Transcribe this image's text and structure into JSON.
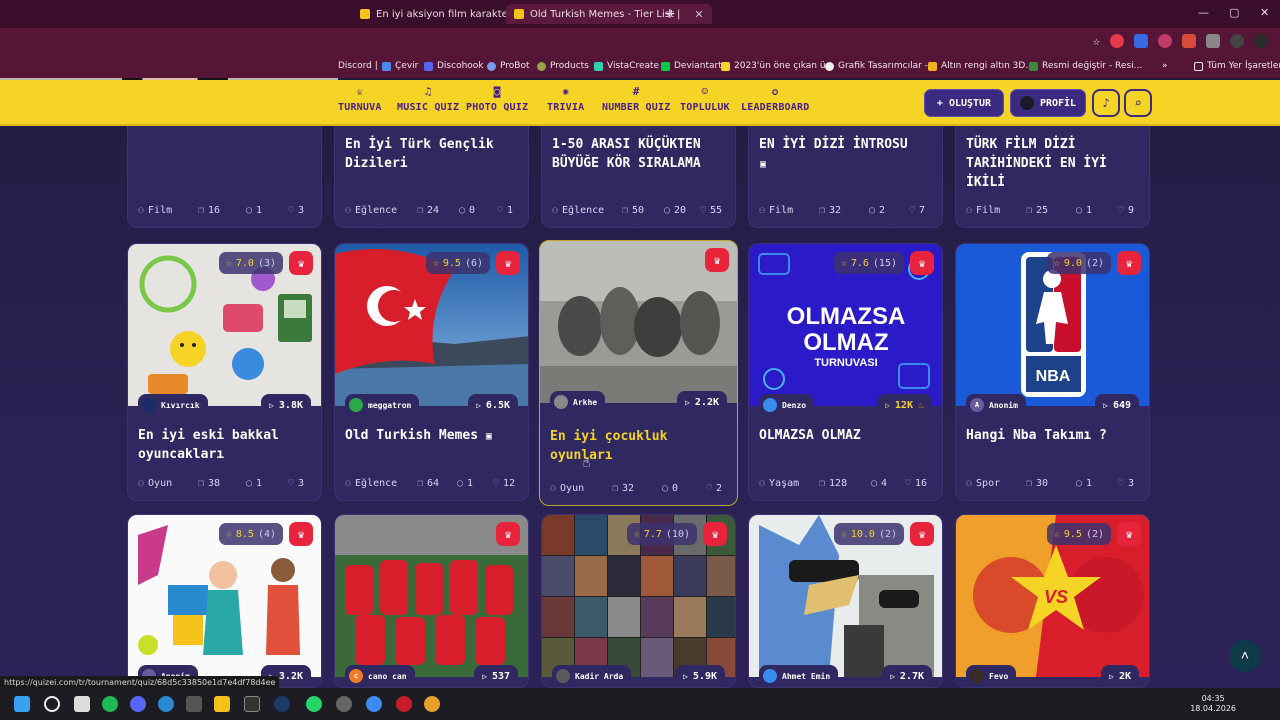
{
  "browser": {
    "tabs": [
      {
        "title": "En iyi aksiyon film karakterleri(GÜ"
      },
      {
        "title": "Old Turkish Memes - Tier List |"
      }
    ],
    "new_tab": "+",
    "window_controls": {
      "min": "—",
      "max": "▢",
      "close": "✕"
    },
    "bookmarks": [
      {
        "label": "Discord |"
      },
      {
        "label": "Çevir"
      },
      {
        "label": "Discohook"
      },
      {
        "label": "ProBot"
      },
      {
        "label": "Products"
      },
      {
        "label": "VistaCreate"
      },
      {
        "label": "Deviantart"
      },
      {
        "label": "2023'ün öne çıkan ü..."
      },
      {
        "label": "Grafik Tasarımcılar -..."
      },
      {
        "label": "Altın rengi altın 3D..."
      },
      {
        "label": "Resmi değiştir - Resi..."
      },
      {
        "label": "»"
      },
      {
        "label": "Tüm Yer İşaretleri"
      }
    ],
    "status_url": "https://quizei.com/tr/tournament/quiz/68d5c33850e1d7e4df78d4ee"
  },
  "navbar": {
    "items": [
      {
        "label": "TURNUVA",
        "icon": "trophy-icon"
      },
      {
        "label": "MUSIC QUIZ",
        "icon": "music-icon"
      },
      {
        "label": "PHOTO QUIZ",
        "icon": "camera-icon"
      },
      {
        "label": "TRIVIA",
        "icon": "brain-icon"
      },
      {
        "label": "NUMBER QUIZ",
        "icon": "hash-icon"
      },
      {
        "label": "TOPLULUK",
        "icon": "users-icon"
      },
      {
        "label": "LEADERBOARD",
        "icon": "medal-icon"
      }
    ],
    "create_label": "OLUŞTUR",
    "profile_label": "PROFİL"
  },
  "row1": [
    {
      "title": "En İyi Türk Gençlik Dizileri",
      "category": "Film",
      "items": "16",
      "comments": "1",
      "likes": "3"
    },
    {
      "title": "En İyi Türk Gençlik Dizileri",
      "category": "Eğlence",
      "items": "24",
      "comments": "0",
      "likes": "1"
    },
    {
      "title": "1-50 ARASI KÜÇÜKTEN BÜYÜĞE KÖR SIRALAMA",
      "category": "Eğlence",
      "items": "50",
      "comments": "20",
      "likes": "55"
    },
    {
      "title": "EN İYİ DİZİ İNTROSU",
      "category": "Film",
      "items": "32",
      "comments": "2",
      "likes": "7"
    },
    {
      "title": "TÜRK FİLM DİZİ TARİHİNDEKİ EN İYİ İKİLİ",
      "category": "Film",
      "items": "25",
      "comments": "1",
      "likes": "9"
    }
  ],
  "row2": [
    {
      "title": "En iyi eski bakkal oyuncakları",
      "rating": "7.0",
      "rating_count": "(3)",
      "author": "Kıvırcık",
      "plays": "3.8K",
      "category": "Oyun",
      "items": "38",
      "comments": "1",
      "likes": "3"
    },
    {
      "title": "Old Turkish Memes",
      "rating": "9.5",
      "rating_count": "(6)",
      "author": "meggatron",
      "plays": "6.5K",
      "category": "Eğlence",
      "items": "64",
      "comments": "1",
      "likes": "12"
    },
    {
      "title": "En iyi çocukluk oyunları",
      "rating": "",
      "rating_count": "",
      "author": "Arkhe",
      "plays": "2.2K",
      "category": "Oyun",
      "items": "32",
      "comments": "0",
      "likes": "2"
    },
    {
      "title": "OLMAZSA OLMAZ",
      "rating": "7.6",
      "rating_count": "(15)",
      "author": "Denzo",
      "plays": "12K",
      "category": "Yaşam",
      "items": "128",
      "comments": "4",
      "likes": "16"
    },
    {
      "title": "Hangi Nba Takımı ?",
      "rating": "9.0",
      "rating_count": "(2)",
      "author": "Anonim",
      "plays": "649",
      "category": "Spor",
      "items": "30",
      "comments": "1",
      "likes": "3"
    }
  ],
  "row3": [
    {
      "rating": "8.5",
      "rating_count": "(4)",
      "author": "Anonim",
      "plays": "3.2K"
    },
    {
      "rating": "",
      "rating_count": "",
      "author": "cano can",
      "plays": "537"
    },
    {
      "rating": "7.7",
      "rating_count": "(10)",
      "author": "Kadir Arda",
      "plays": "5.9K"
    },
    {
      "rating": "10.0",
      "rating_count": "(2)",
      "author": "Ahmet Emin",
      "plays": "2.7K"
    },
    {
      "rating": "9.5",
      "rating_count": "(2)",
      "author": "Fevo",
      "plays": "2K"
    }
  ],
  "thumbs": {
    "olmazsa_line1": "OLMAZSA",
    "olmazsa_line2": "OLMAZ",
    "olmazsa_line3": "TURNUVASI",
    "nba": "NBA",
    "vs": "VS"
  },
  "taskbar": {
    "time": "04:35",
    "date": "18.04.2026"
  },
  "colors": {
    "accent_yellow": "#f5d426",
    "nav_purple": "#3a2a80",
    "card_bg": "#2f2861",
    "crown_red": "#e8243c"
  }
}
